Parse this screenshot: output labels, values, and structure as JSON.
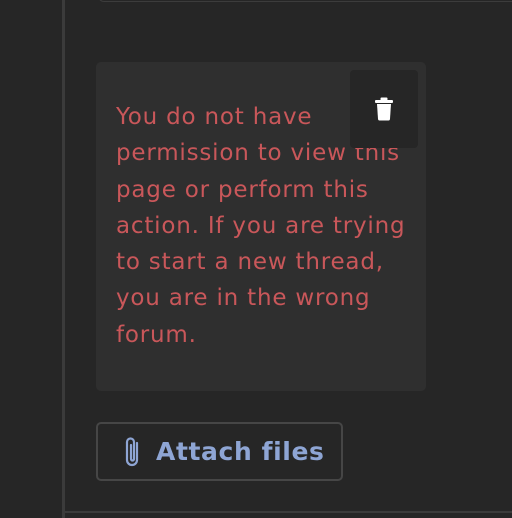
{
  "error": {
    "message": "You do not have permission to view this page or perform this action. If you are trying to start a new thread, you are in the wrong forum.",
    "color": "#c9575a"
  },
  "delete_button": {
    "icon": "trash-icon"
  },
  "attach_button": {
    "label": "Attach files",
    "icon": "paperclip-icon",
    "color": "#8ea5d4"
  },
  "colors": {
    "background": "#262626",
    "panel": "#2f2f2f",
    "border": "#464646"
  }
}
